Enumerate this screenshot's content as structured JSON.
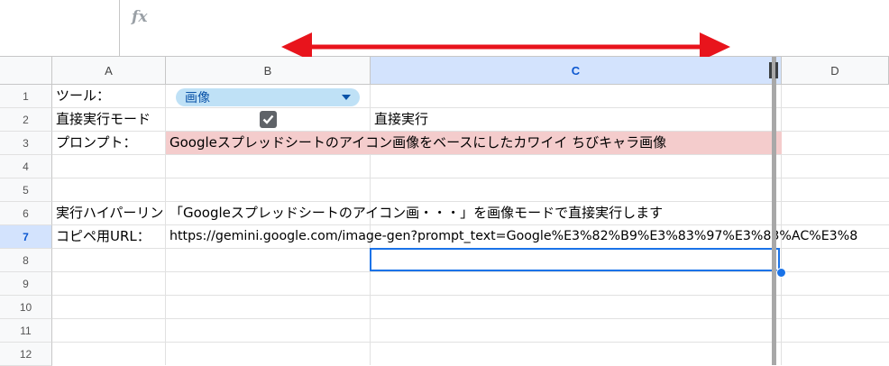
{
  "formula_bar": {
    "fx_label": "fx"
  },
  "columns": [
    "A",
    "B",
    "C",
    "D"
  ],
  "rows": [
    "1",
    "2",
    "3",
    "4",
    "5",
    "6",
    "7",
    "8",
    "9",
    "10",
    "11",
    "12"
  ],
  "selected_column": "C",
  "selected_row": "7",
  "cells": {
    "a1": "ツール：",
    "b1_dropdown": "画像",
    "a2": "直接実行モード",
    "b2_checked": true,
    "c2": "直接実行",
    "a3": "プロンプト：",
    "b3": "Googleスプレッドシートのアイコン画像をベースにしたカワイイ ちびキャラ画像",
    "a5": "実行ハイパーリン",
    "b5": "「Googleスプレッドシートのアイコン画・・・」を画像モードで直接実行します",
    "a6": "コピペ用URL：",
    "b6": "https://gemini.google.com/image-gen?prompt_text=Google%E3%82%B9%E3%83%97%E3%83%AC%E3%8"
  },
  "colors": {
    "accent": "#1a73e8",
    "arrow": "#e8141c",
    "prompt_fill": "#f4cccc",
    "chip_fill": "#bfe1f6"
  }
}
